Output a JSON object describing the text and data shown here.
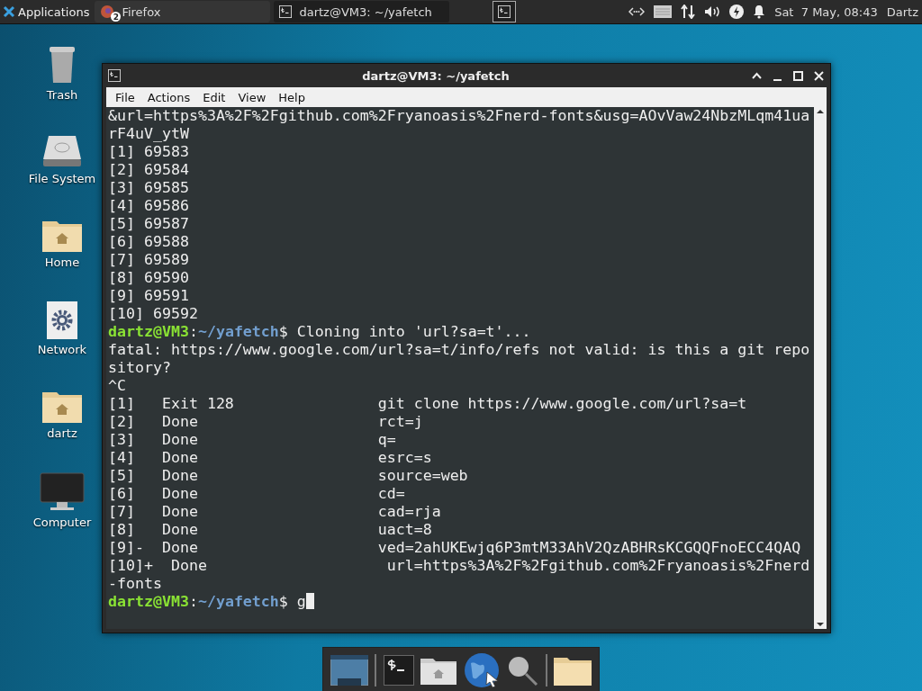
{
  "panel": {
    "menu_label": "Applications",
    "tasks": [
      {
        "kind": "browser",
        "label": "Firefox",
        "badge": "2",
        "selected": false
      },
      {
        "kind": "terminal",
        "label": "dartz@VM3: ~/yafetch",
        "selected": true
      }
    ],
    "clock": "Sat  7 May, 08:43",
    "user": "Dartz"
  },
  "desktop_icons": [
    {
      "kind": "trash",
      "label": "Trash"
    },
    {
      "kind": "drive",
      "label": "File System"
    },
    {
      "kind": "home",
      "label": "Home"
    },
    {
      "kind": "network",
      "label": "Network"
    },
    {
      "kind": "home",
      "label": "dartz"
    },
    {
      "kind": "monitor",
      "label": "Computer"
    }
  ],
  "window": {
    "title": "dartz@VM3: ~/yafetch",
    "menu": [
      "File",
      "Actions",
      "Edit",
      "View",
      "Help"
    ]
  },
  "terminal": {
    "lines": [
      [
        {
          "kind": "plain",
          "text": "&url=https%3A%2F%2Fgithub.com%2Fryanoasis%2Fnerd-fonts&usg=AOvVaw24NbzMLqm41ua"
        }
      ],
      [
        {
          "kind": "plain",
          "text": "rF4uV_ytW"
        }
      ],
      [
        {
          "kind": "plain",
          "text": "[1] 69583"
        }
      ],
      [
        {
          "kind": "plain",
          "text": "[2] 69584"
        }
      ],
      [
        {
          "kind": "plain",
          "text": "[3] 69585"
        }
      ],
      [
        {
          "kind": "plain",
          "text": "[4] 69586"
        }
      ],
      [
        {
          "kind": "plain",
          "text": "[5] 69587"
        }
      ],
      [
        {
          "kind": "plain",
          "text": "[6] 69588"
        }
      ],
      [
        {
          "kind": "plain",
          "text": "[7] 69589"
        }
      ],
      [
        {
          "kind": "plain",
          "text": "[8] 69590"
        }
      ],
      [
        {
          "kind": "plain",
          "text": "[9] 69591"
        }
      ],
      [
        {
          "kind": "plain",
          "text": "[10] 69592"
        }
      ],
      [
        {
          "kind": "user",
          "text": "dartz@VM3"
        },
        {
          "kind": "plain",
          "text": ":"
        },
        {
          "kind": "path",
          "text": "~/yafetch"
        },
        {
          "kind": "plain",
          "text": "$ Cloning into 'url?sa=t'..."
        }
      ],
      [
        {
          "kind": "plain",
          "text": "fatal: https://www.google.com/url?sa=t/info/refs not valid: is this a git repo"
        }
      ],
      [
        {
          "kind": "plain",
          "text": "sitory?"
        }
      ],
      [
        {
          "kind": "plain",
          "text": "^C"
        }
      ],
      [
        {
          "kind": "plain",
          "text": "[1]   Exit 128                git clone https://www.google.com/url?sa=t"
        }
      ],
      [
        {
          "kind": "plain",
          "text": "[2]   Done                    rct=j"
        }
      ],
      [
        {
          "kind": "plain",
          "text": "[3]   Done                    q="
        }
      ],
      [
        {
          "kind": "plain",
          "text": "[4]   Done                    esrc=s"
        }
      ],
      [
        {
          "kind": "plain",
          "text": "[5]   Done                    source=web"
        }
      ],
      [
        {
          "kind": "plain",
          "text": "[6]   Done                    cd="
        }
      ],
      [
        {
          "kind": "plain",
          "text": "[7]   Done                    cad=rja"
        }
      ],
      [
        {
          "kind": "plain",
          "text": "[8]   Done                    uact=8"
        }
      ],
      [
        {
          "kind": "plain",
          "text": "[9]-  Done                    ved=2ahUKEwjq6P3mtM33AhV2QzABHRsKCGQQFnoECC4QAQ"
        }
      ],
      [
        {
          "kind": "plain",
          "text": "[10]+  Done                    url=https%3A%2F%2Fgithub.com%2Fryanoasis%2Fnerd"
        }
      ],
      [
        {
          "kind": "plain",
          "text": "-fonts"
        }
      ],
      [
        {
          "kind": "user",
          "text": "dartz@VM3"
        },
        {
          "kind": "plain",
          "text": ":"
        },
        {
          "kind": "path",
          "text": "~/yafetch"
        },
        {
          "kind": "plain",
          "text": "$ g"
        },
        {
          "kind": "cursor"
        }
      ]
    ]
  },
  "dock": [
    {
      "kind": "desktop"
    },
    {
      "kind": "terminal"
    },
    {
      "kind": "home"
    },
    {
      "kind": "globe"
    },
    {
      "kind": "search"
    },
    {
      "kind": "folder"
    }
  ]
}
